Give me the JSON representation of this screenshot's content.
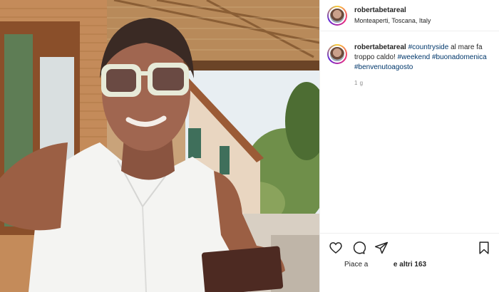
{
  "post": {
    "username": "robertabetareal",
    "location": "Monteaperti, Toscana, Italy",
    "caption": {
      "username": "robertabetareal",
      "tag_countryside": "#countryside",
      "text_1": " al mare fa troppo caldo! ",
      "tag_weekend": "#weekend",
      "tag_buonadomenica": "#buonadomenica",
      "tag_benvenutoagosto": "#benvenutoagosto"
    },
    "age": "1 g",
    "likes_prefix": "Piace a",
    "likes_others": "e altri 163"
  },
  "icons": {
    "like": "heart-icon",
    "comment": "comment-icon",
    "share": "share-icon",
    "save": "bookmark-icon"
  },
  "colors": {
    "hashtag": "#00376b",
    "text": "#262626",
    "muted": "#8e8e8e"
  }
}
